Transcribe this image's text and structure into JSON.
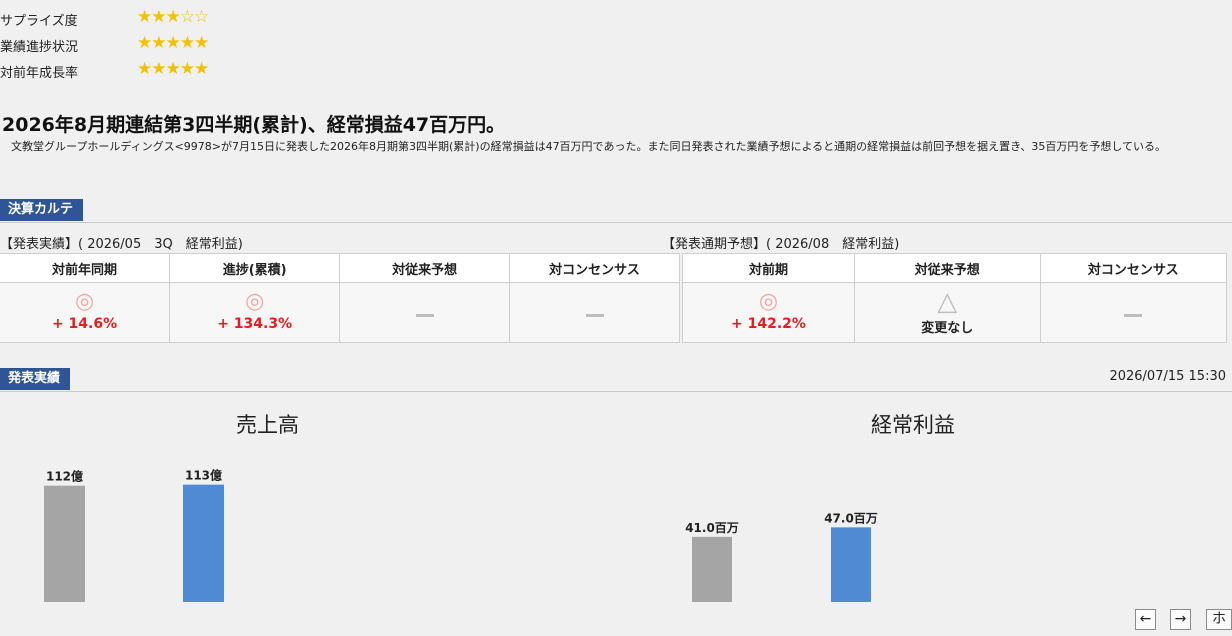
{
  "ratings": [
    {
      "label": "サプライズ度",
      "stars": "★★★☆☆"
    },
    {
      "label": "業績進捗状況",
      "stars": "★★★★★"
    },
    {
      "label": "対前年成長率",
      "stars": "★★★★★"
    }
  ],
  "headline": "2026年8月期連結第3四半期(累計)、経常損益47百万円。",
  "summary": "　文教堂グループホールディングス<9978>が7月15日に発表した2026年8月期第3四半期(累計)の経常損益は47百万円であった。また同日発表された業績予想によると通期の経常損益は前回予想を据え置き、35百万円を予想している。",
  "karte": {
    "title": "決算カルテ",
    "left_label": "【発表実績】( 2026/05　3Q　経常利益)",
    "right_label": "【発表通期予想】( 2026/08　経常利益)",
    "left_headers": [
      "対前年同期",
      "進捗(累積)",
      "対従来予想",
      "対コンセンサス"
    ],
    "right_headers": [
      "対前期",
      "対従来予想",
      "対コンセンサス"
    ],
    "left_cells": [
      {
        "symbol": "◎",
        "value": "+ 14.6%"
      },
      {
        "symbol": "◎",
        "value": "+ 134.3%"
      },
      {
        "symbol": "",
        "value": ""
      },
      {
        "symbol": "",
        "value": ""
      }
    ],
    "right_cells": [
      {
        "symbol": "◎",
        "value": "+ 142.2%"
      },
      {
        "symbol": "△",
        "text": "変更なし"
      },
      {
        "symbol": "",
        "value": ""
      }
    ]
  },
  "results": {
    "title": "発表実績",
    "timestamp": "2026/07/15 15:30"
  },
  "chart_data": [
    {
      "type": "bar",
      "title": "売上高",
      "values": [
        112,
        113
      ],
      "data_labels": [
        "112億",
        "113億"
      ],
      "colors": [
        "#a5a5a5",
        "#4f8ad3"
      ],
      "ylim": [
        0,
        130
      ]
    },
    {
      "type": "bar",
      "title": "経常利益",
      "values": [
        41.0,
        47.0
      ],
      "data_labels": [
        "41.0百万",
        "47.0百万"
      ],
      "colors": [
        "#a5a5a5",
        "#4f8ad3"
      ],
      "ylim": [
        0,
        85
      ]
    }
  ],
  "nav": {
    "prev": "←",
    "next": "→",
    "home": "ホ"
  }
}
